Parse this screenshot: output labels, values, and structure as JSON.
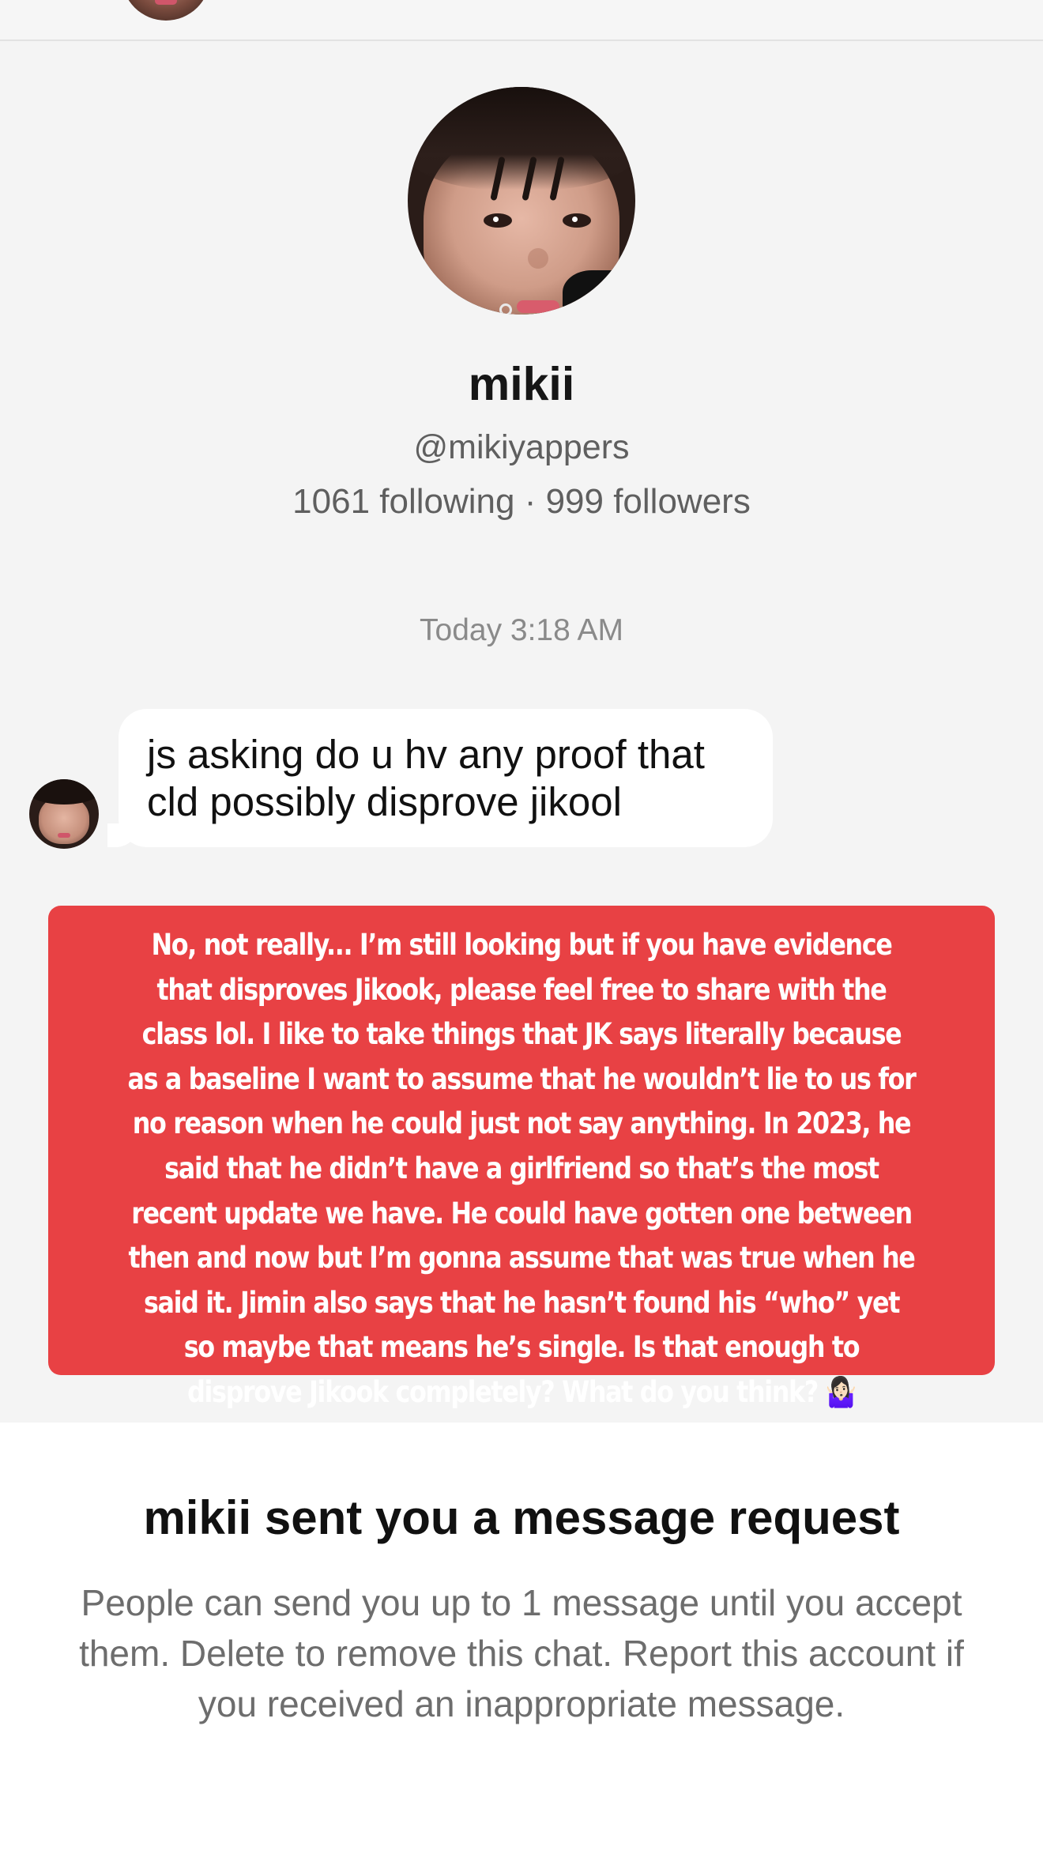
{
  "profile": {
    "name": "mikii",
    "handle": "@mikiyappers",
    "stats": "1061 following · 999 followers"
  },
  "conversation": {
    "timestamp": "Today 3:18 AM",
    "incoming_message": "js asking do u hv any proof that cld possibly disprove jikool",
    "reply_card_text": "No, not really... I’m still looking but if you have evidence that disproves Jikook, please feel free to share with the class lol. I like to take things that JK says literally because as a baseline I want to assume that he wouldn’t lie to us for no reason when he could just not say anything. In 2023, he said that he didn’t have a girlfriend so that’s the most recent update we have. He could have gotten one between then and now but I’m gonna assume that was true when he said it. Jimin also says that he hasn’t found his “who” yet so maybe that means he’s single. Is that enough to disprove Jikook completely? What do you think? 🤷🏻‍♀️",
    "reply_card_color": "#e84144"
  },
  "message_request": {
    "title": "mikii sent you a message request",
    "description": "People can send you up to 1 message until you accept them. Delete to remove this chat. Report this account if you received an inappropriate message."
  }
}
